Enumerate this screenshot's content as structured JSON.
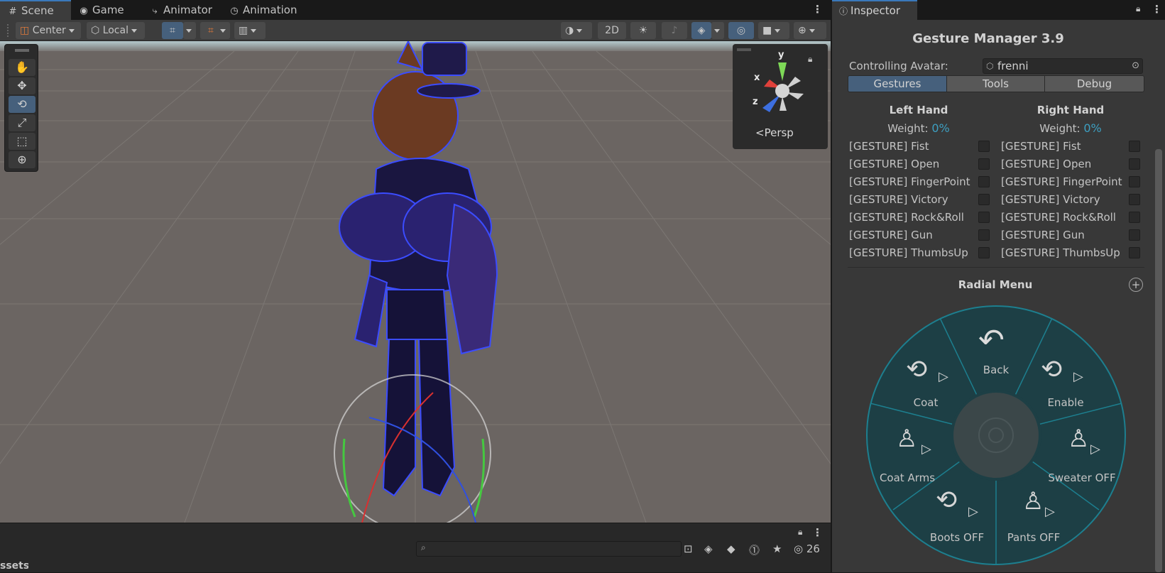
{
  "scene_tabs": [
    {
      "label": "Scene",
      "icon": "grid-icon"
    },
    {
      "label": "Game",
      "icon": "gamepad-icon"
    },
    {
      "label": "Animator",
      "icon": "animator-icon"
    },
    {
      "label": "Animation",
      "icon": "clock-icon"
    }
  ],
  "toolbar": {
    "pivot_label": "Center",
    "space_label": "Local",
    "mode_2d_label": "2D"
  },
  "scene": {
    "gizmo_axes": {
      "y": "y",
      "x": "x",
      "z": "z"
    },
    "gizmo_view": "Persp",
    "visibility_count": "26",
    "bottom_label": "ssets"
  },
  "inspector": {
    "tab_label": "Inspector",
    "title": "Gesture Manager 3.9",
    "controlling_avatar_label": "Controlling Avatar:",
    "controlling_avatar_value": "frenni",
    "mode_tabs": [
      "Gestures",
      "Tools",
      "Debug"
    ],
    "left_hand": {
      "title": "Left Hand",
      "weight_label": "Weight:",
      "weight_value": "0%",
      "gestures": [
        "[GESTURE] Fist",
        "[GESTURE] Open",
        "[GESTURE] FingerPoint",
        "[GESTURE] Victory",
        "[GESTURE] Rock&Roll",
        "[GESTURE] Gun",
        "[GESTURE] ThumbsUp"
      ]
    },
    "right_hand": {
      "title": "Right Hand",
      "weight_label": "Weight:",
      "weight_value": "0%",
      "gestures": [
        "[GESTURE] Fist",
        "[GESTURE] Open",
        "[GESTURE] FingerPoint",
        "[GESTURE] Victory",
        "[GESTURE] Rock&Roll",
        "[GESTURE] Gun",
        "[GESTURE] ThumbsUp"
      ]
    },
    "radial_menu": {
      "title": "Radial Menu",
      "items": [
        "Back",
        "Enable",
        "Sweater OFF",
        "Pants OFF",
        "Boots OFF",
        "Coat Arms",
        "Coat"
      ]
    }
  },
  "colors": {
    "accent": "#3a79bb",
    "selected": "#46607c",
    "weight_value": "#3d9fc1",
    "radial_ring": "#1d7f8f",
    "radial_fill": "#1d3f45"
  }
}
